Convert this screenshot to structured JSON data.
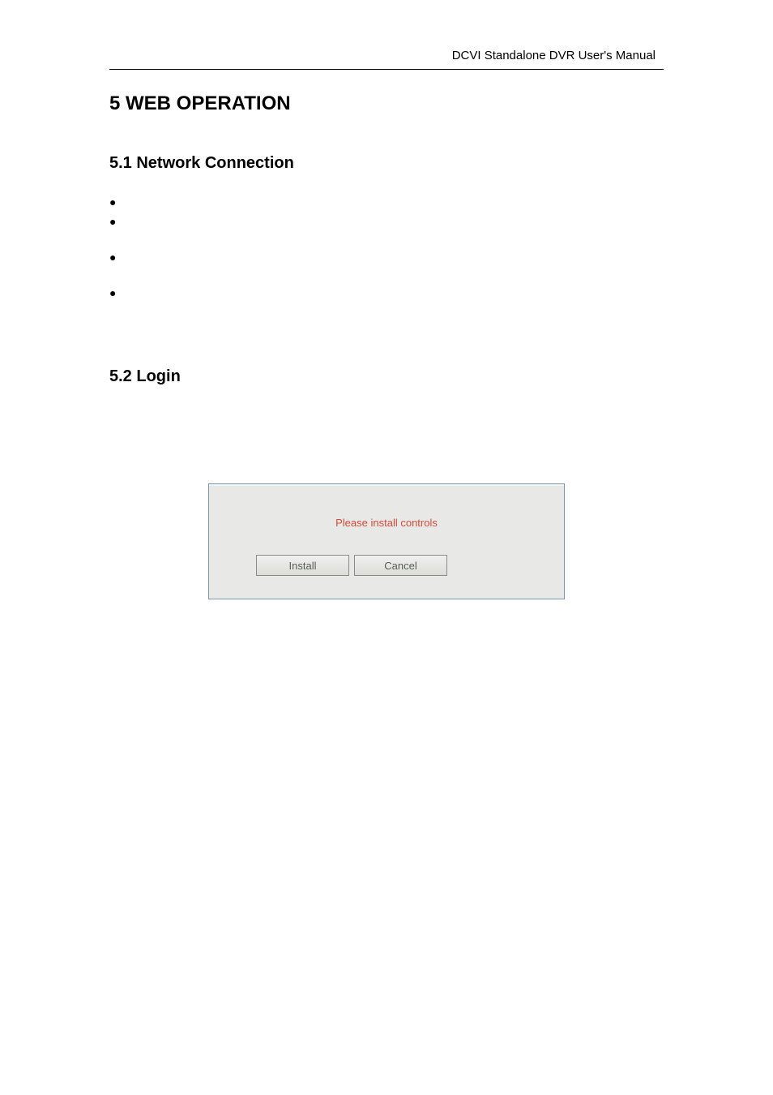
{
  "header": {
    "doc_title": "DCVI Standalone DVR User's Manual"
  },
  "chapter": {
    "title": "5  WEB OPERATION"
  },
  "section_51": {
    "title": "5.1  Network Connection",
    "bullets": [
      "",
      "",
      "",
      ""
    ]
  },
  "section_52": {
    "title": "5.2  Login"
  },
  "dialog": {
    "message": "Please install controls",
    "install_label": "Install",
    "cancel_label": "Cancel"
  }
}
